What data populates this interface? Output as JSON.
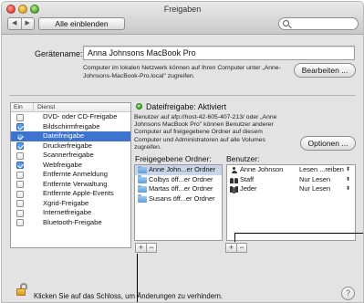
{
  "window": {
    "title": "Freigaben",
    "show_all_label": "Alle einblenden",
    "nav_back": "◀",
    "nav_forward": "▶"
  },
  "computer_name": {
    "label": "Gerätename:",
    "value": "Anna Johnsons MacBook Pro",
    "note": "Computer im lokalen Netzwerk können auf Ihren Computer unter „Anne-Johnsons-MacBook-Pro.local\" zugreifen.",
    "edit_label": "Bearbeiten ..."
  },
  "services": {
    "header_on": "Ein",
    "header_service": "Dienst",
    "items": [
      {
        "label": "DVD- oder CD-Freigabe",
        "checked": false,
        "selected": false
      },
      {
        "label": "Bildschirmfreigabe",
        "checked": true,
        "selected": false
      },
      {
        "label": "Dateifreigabe",
        "checked": true,
        "selected": true
      },
      {
        "label": "Druckerfreigabe",
        "checked": true,
        "selected": false
      },
      {
        "label": "Scannerfreigabe",
        "checked": false,
        "selected": false
      },
      {
        "label": "Webfreigabe",
        "checked": true,
        "selected": false
      },
      {
        "label": "Entfernte Anmeldung",
        "checked": false,
        "selected": false
      },
      {
        "label": "Entfernte Verwaltung",
        "checked": false,
        "selected": false
      },
      {
        "label": "Entfernte Apple-Events",
        "checked": false,
        "selected": false
      },
      {
        "label": "Xgrid-Freigabe",
        "checked": false,
        "selected": false
      },
      {
        "label": "Internetfreigabe",
        "checked": false,
        "selected": false
      },
      {
        "label": "Bluetooth-Freigabe",
        "checked": false,
        "selected": false
      }
    ]
  },
  "status": {
    "text": "Dateifreigabe: Aktiviert",
    "description": "Benutzer auf afp://host-42-605-407-213/ oder „Anne Johnsons MacBook Pro\" können Benutzer anderer Computer auf freigegebene Ordner auf diesem Computer und Administratoren auf alle Volumes zugreifen.",
    "options_label": "Optionen ..."
  },
  "shared_folders": {
    "label": "Freigegebene Ordner:",
    "items": [
      "Anne John...er Ordner",
      "Colbys öff...er Ordner",
      "Martas öff...er Ordner",
      "Susans öff...er Ordner"
    ]
  },
  "users": {
    "label": "Benutzer:",
    "items": [
      {
        "name": "Anne Johnson",
        "permission": "Lesen ...reiben",
        "icon": "user-icon"
      },
      {
        "name": "Staff",
        "permission": "Nur Lesen",
        "icon": "group-icon"
      },
      {
        "name": "Jeder",
        "permission": "Nur Lesen",
        "icon": "everyone-icon"
      }
    ]
  },
  "buttons": {
    "plus": "+",
    "minus": "−"
  },
  "footer": {
    "lock_text": "Klicken Sie auf das Schloss, um Änderungen zu verhindern.",
    "help": "?"
  }
}
